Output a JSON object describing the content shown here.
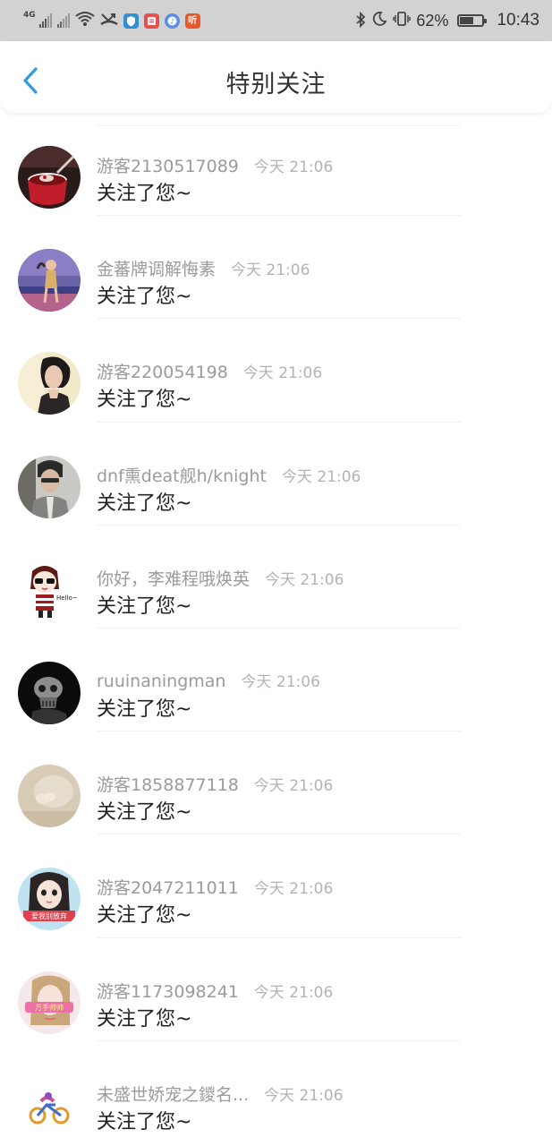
{
  "status_bar": {
    "network": "4G",
    "battery": "62%",
    "battery_level": 0.62,
    "time": "10:43",
    "app_icons": [
      "shield-app-icon",
      "notes-app-icon",
      "music-app-icon",
      "ting-app-icon"
    ],
    "ting_label": "听"
  },
  "header": {
    "title": "特别关注"
  },
  "colors": {
    "accent": "#2f9be5",
    "status_bar_bg": "#d2d2d2",
    "username": "#9b9b9b",
    "timestamp": "#b3b3b3",
    "message": "#222222"
  },
  "notifications": [
    {
      "username": "游客2130517089",
      "time": "今天 21:06",
      "message": "关注了您~"
    },
    {
      "username": "金蕃牌调解悔素",
      "time": "今天 21:06",
      "message": "关注了您~"
    },
    {
      "username": "游客220054198",
      "time": "今天 21:06",
      "message": "关注了您~"
    },
    {
      "username": "dnf熏deat舰h/knight",
      "time": "今天 21:06",
      "message": "关注了您~"
    },
    {
      "username": "你好，李难程哦焕英",
      "time": "今天 21:06",
      "message": "关注了您~"
    },
    {
      "username": "ruuinaningman",
      "time": "今天 21:06",
      "message": "关注了您~"
    },
    {
      "username": "游客1858877118",
      "time": "今天 21:06",
      "message": "关注了您~"
    },
    {
      "username": "游客2047211011",
      "time": "今天 21:06",
      "message": "关注了您~"
    },
    {
      "username": "游客1173098241",
      "time": "今天 21:06",
      "message": "关注了您~"
    },
    {
      "username": "未盛世娇宠之鑁名...",
      "time": "今天 21:06",
      "message": "关注了您~"
    }
  ],
  "avatar_texts": {
    "hello": "Hello~",
    "banner_8": "爱我别放弃",
    "banner_9": "万手帅帅"
  }
}
